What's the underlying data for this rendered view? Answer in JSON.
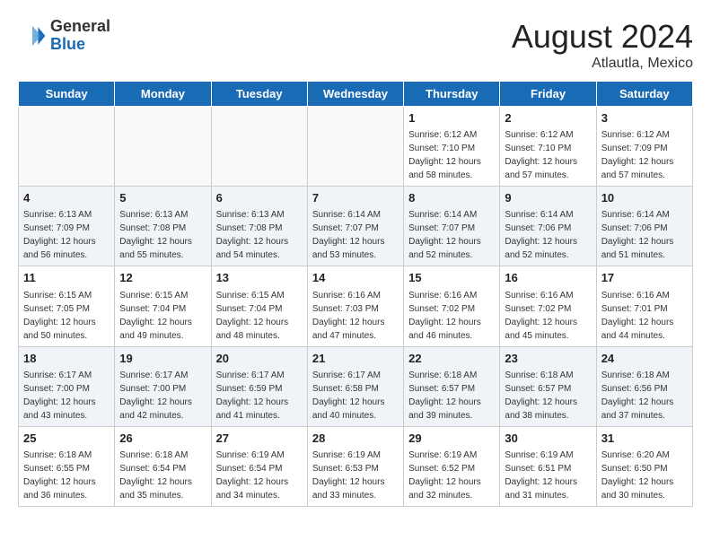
{
  "header": {
    "logo_general": "General",
    "logo_blue": "Blue",
    "month_year": "August 2024",
    "location": "Atlautla, Mexico"
  },
  "weekdays": [
    "Sunday",
    "Monday",
    "Tuesday",
    "Wednesday",
    "Thursday",
    "Friday",
    "Saturday"
  ],
  "weeks": [
    [
      {
        "day": "",
        "info": ""
      },
      {
        "day": "",
        "info": ""
      },
      {
        "day": "",
        "info": ""
      },
      {
        "day": "",
        "info": ""
      },
      {
        "day": "1",
        "info": "Sunrise: 6:12 AM\nSunset: 7:10 PM\nDaylight: 12 hours\nand 58 minutes."
      },
      {
        "day": "2",
        "info": "Sunrise: 6:12 AM\nSunset: 7:10 PM\nDaylight: 12 hours\nand 57 minutes."
      },
      {
        "day": "3",
        "info": "Sunrise: 6:12 AM\nSunset: 7:09 PM\nDaylight: 12 hours\nand 57 minutes."
      }
    ],
    [
      {
        "day": "4",
        "info": "Sunrise: 6:13 AM\nSunset: 7:09 PM\nDaylight: 12 hours\nand 56 minutes."
      },
      {
        "day": "5",
        "info": "Sunrise: 6:13 AM\nSunset: 7:08 PM\nDaylight: 12 hours\nand 55 minutes."
      },
      {
        "day": "6",
        "info": "Sunrise: 6:13 AM\nSunset: 7:08 PM\nDaylight: 12 hours\nand 54 minutes."
      },
      {
        "day": "7",
        "info": "Sunrise: 6:14 AM\nSunset: 7:07 PM\nDaylight: 12 hours\nand 53 minutes."
      },
      {
        "day": "8",
        "info": "Sunrise: 6:14 AM\nSunset: 7:07 PM\nDaylight: 12 hours\nand 52 minutes."
      },
      {
        "day": "9",
        "info": "Sunrise: 6:14 AM\nSunset: 7:06 PM\nDaylight: 12 hours\nand 52 minutes."
      },
      {
        "day": "10",
        "info": "Sunrise: 6:14 AM\nSunset: 7:06 PM\nDaylight: 12 hours\nand 51 minutes."
      }
    ],
    [
      {
        "day": "11",
        "info": "Sunrise: 6:15 AM\nSunset: 7:05 PM\nDaylight: 12 hours\nand 50 minutes."
      },
      {
        "day": "12",
        "info": "Sunrise: 6:15 AM\nSunset: 7:04 PM\nDaylight: 12 hours\nand 49 minutes."
      },
      {
        "day": "13",
        "info": "Sunrise: 6:15 AM\nSunset: 7:04 PM\nDaylight: 12 hours\nand 48 minutes."
      },
      {
        "day": "14",
        "info": "Sunrise: 6:16 AM\nSunset: 7:03 PM\nDaylight: 12 hours\nand 47 minutes."
      },
      {
        "day": "15",
        "info": "Sunrise: 6:16 AM\nSunset: 7:02 PM\nDaylight: 12 hours\nand 46 minutes."
      },
      {
        "day": "16",
        "info": "Sunrise: 6:16 AM\nSunset: 7:02 PM\nDaylight: 12 hours\nand 45 minutes."
      },
      {
        "day": "17",
        "info": "Sunrise: 6:16 AM\nSunset: 7:01 PM\nDaylight: 12 hours\nand 44 minutes."
      }
    ],
    [
      {
        "day": "18",
        "info": "Sunrise: 6:17 AM\nSunset: 7:00 PM\nDaylight: 12 hours\nand 43 minutes."
      },
      {
        "day": "19",
        "info": "Sunrise: 6:17 AM\nSunset: 7:00 PM\nDaylight: 12 hours\nand 42 minutes."
      },
      {
        "day": "20",
        "info": "Sunrise: 6:17 AM\nSunset: 6:59 PM\nDaylight: 12 hours\nand 41 minutes."
      },
      {
        "day": "21",
        "info": "Sunrise: 6:17 AM\nSunset: 6:58 PM\nDaylight: 12 hours\nand 40 minutes."
      },
      {
        "day": "22",
        "info": "Sunrise: 6:18 AM\nSunset: 6:57 PM\nDaylight: 12 hours\nand 39 minutes."
      },
      {
        "day": "23",
        "info": "Sunrise: 6:18 AM\nSunset: 6:57 PM\nDaylight: 12 hours\nand 38 minutes."
      },
      {
        "day": "24",
        "info": "Sunrise: 6:18 AM\nSunset: 6:56 PM\nDaylight: 12 hours\nand 37 minutes."
      }
    ],
    [
      {
        "day": "25",
        "info": "Sunrise: 6:18 AM\nSunset: 6:55 PM\nDaylight: 12 hours\nand 36 minutes."
      },
      {
        "day": "26",
        "info": "Sunrise: 6:18 AM\nSunset: 6:54 PM\nDaylight: 12 hours\nand 35 minutes."
      },
      {
        "day": "27",
        "info": "Sunrise: 6:19 AM\nSunset: 6:54 PM\nDaylight: 12 hours\nand 34 minutes."
      },
      {
        "day": "28",
        "info": "Sunrise: 6:19 AM\nSunset: 6:53 PM\nDaylight: 12 hours\nand 33 minutes."
      },
      {
        "day": "29",
        "info": "Sunrise: 6:19 AM\nSunset: 6:52 PM\nDaylight: 12 hours\nand 32 minutes."
      },
      {
        "day": "30",
        "info": "Sunrise: 6:19 AM\nSunset: 6:51 PM\nDaylight: 12 hours\nand 31 minutes."
      },
      {
        "day": "31",
        "info": "Sunrise: 6:20 AM\nSunset: 6:50 PM\nDaylight: 12 hours\nand 30 minutes."
      }
    ]
  ]
}
